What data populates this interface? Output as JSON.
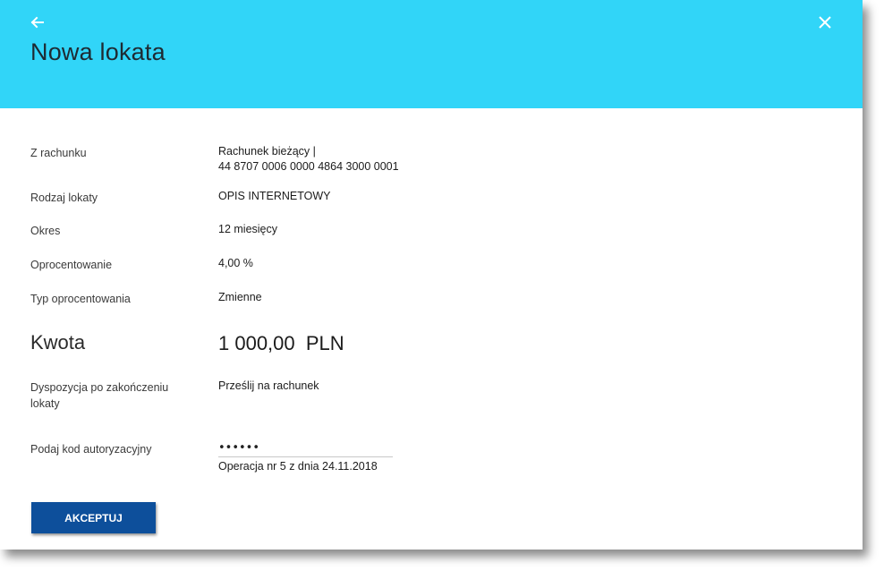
{
  "header": {
    "title": "Nowa lokata",
    "back_icon": "arrow-left-icon",
    "close_icon": "close-icon",
    "background_color": "#31d5f8"
  },
  "form": {
    "account": {
      "label": "Z rachunku",
      "value_line1": "Rachunek bieżący |",
      "value_line2": "44 8707 0006 0000 4864 3000 0001"
    },
    "deposit_type": {
      "label": "Rodzaj lokaty",
      "value": "OPIS INTERNETOWY"
    },
    "period": {
      "label": "Okres",
      "value": "12 miesięcy"
    },
    "interest": {
      "label": "Oprocentowanie",
      "value": "4,00 %"
    },
    "interest_type": {
      "label": "Typ oprocentowania",
      "value": "Zmienne"
    },
    "amount": {
      "label": "Kwota",
      "value": "1 000,00  PLN"
    },
    "disposition": {
      "label": "Dyspozycja po zakończeniu lokaty",
      "value": "Prześlij na rachunek"
    },
    "auth_code": {
      "label": "Podaj kod autoryzacyjny",
      "value": "••••••",
      "hint": "Operacja nr 5 z dnia 24.11.2018"
    }
  },
  "actions": {
    "accept_label": "AKCEPTUJ",
    "accept_color": "#0d4f9b"
  }
}
